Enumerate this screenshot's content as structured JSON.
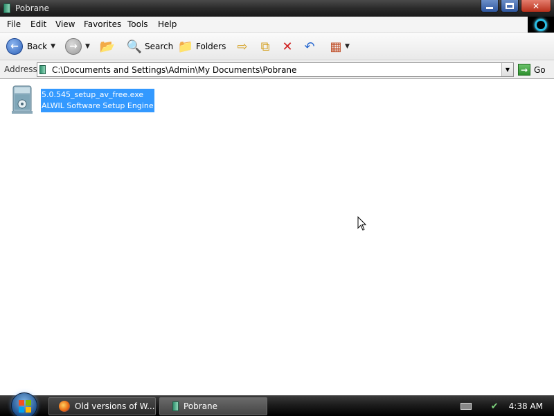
{
  "window": {
    "title": "Pobrane"
  },
  "menu": {
    "items": [
      "File",
      "Edit",
      "View",
      "Favorites",
      "Tools",
      "Help"
    ]
  },
  "toolbar": {
    "back_label": "Back",
    "search_label": "Search",
    "folders_label": "Folders"
  },
  "address": {
    "label": "Address",
    "path": "C:\\Documents and Settings\\Admin\\My Documents\\Pobrane",
    "go_label": "Go"
  },
  "files": [
    {
      "name": "5.0.545_setup_av_free.exe",
      "description": "ALWIL Software Setup Engine",
      "selected": true
    }
  ],
  "taskbar": {
    "tasks": [
      {
        "label": "Old versions of W...",
        "icon": "firefox-icon"
      },
      {
        "label": "Pobrane",
        "icon": "folder-icon",
        "active": true
      }
    ],
    "clock": "4:38 AM"
  },
  "colors": {
    "selection": "#3399ff",
    "taskbar": "#1c1c1c"
  }
}
